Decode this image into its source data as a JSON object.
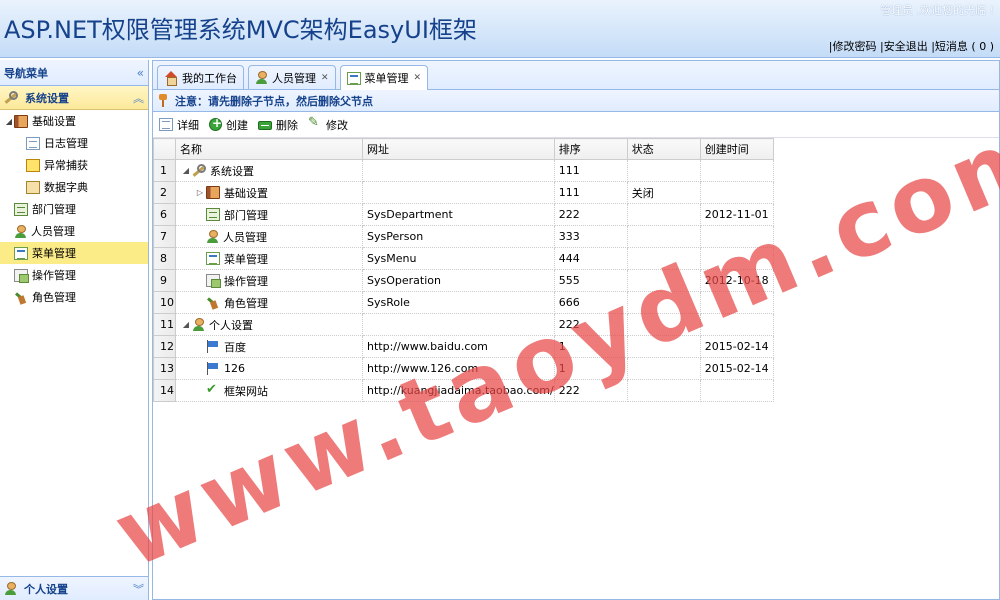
{
  "header": {
    "title": "ASP.NET权限管理系统MVC架构EasyUI框架",
    "welcome": "管理员 ,欢迎您的光临 !",
    "links": [
      "|修改密码",
      "|安全退出",
      "|短消息 ( 0 )"
    ]
  },
  "nav": {
    "title": "导航菜单",
    "collapse_icon": "double-chevron-left-icon",
    "group_top": "系统设置",
    "group_bottom": "个人设置",
    "tree": [
      {
        "label": "基础设置",
        "icon": "book-icon",
        "level": 0,
        "expanded": true
      },
      {
        "label": "日志管理",
        "icon": "log-icon",
        "level": 1
      },
      {
        "label": "异常捕获",
        "icon": "warning-icon",
        "level": 1
      },
      {
        "label": "数据字典",
        "icon": "dictionary-icon",
        "level": 1
      },
      {
        "label": "部门管理",
        "icon": "department-icon",
        "level": 0
      },
      {
        "label": "人员管理",
        "icon": "user-icon",
        "level": 0
      },
      {
        "label": "菜单管理",
        "icon": "menu-icon",
        "level": 0,
        "selected": true
      },
      {
        "label": "操作管理",
        "icon": "operation-icon",
        "level": 0
      },
      {
        "label": "角色管理",
        "icon": "role-icon",
        "level": 0
      }
    ]
  },
  "tabs": [
    {
      "label": "我的工作台",
      "icon": "home-icon",
      "closable": false
    },
    {
      "label": "人员管理",
      "icon": "user-icon",
      "closable": true
    },
    {
      "label": "菜单管理",
      "icon": "menu-icon",
      "closable": true,
      "active": true
    }
  ],
  "notice": "注意：请先删除子节点，然后删除父节点",
  "toolbar": {
    "detail": "详细",
    "create": "创建",
    "delete": "删除",
    "edit": "修改"
  },
  "grid": {
    "columns": [
      "名称",
      "网址",
      "排序",
      "状态",
      "创建时间"
    ],
    "rows": [
      {
        "rn": "1",
        "name": "系统设置",
        "icon": "wrench-icon",
        "indent": 0,
        "toggle": "expanded",
        "url": "",
        "sort": "111",
        "status": "",
        "date": ""
      },
      {
        "rn": "2",
        "name": "基础设置",
        "icon": "book-icon",
        "indent": 1,
        "toggle": "collapsed",
        "url": "",
        "sort": "111",
        "status": "关闭",
        "date": ""
      },
      {
        "rn": "6",
        "name": "部门管理",
        "icon": "department-icon",
        "indent": 1,
        "toggle": "none",
        "url": "SysDepartment",
        "sort": "222",
        "status": "",
        "date": "2012-11-01"
      },
      {
        "rn": "7",
        "name": "人员管理",
        "icon": "user-icon",
        "indent": 1,
        "toggle": "none",
        "url": "SysPerson",
        "sort": "333",
        "status": "",
        "date": ""
      },
      {
        "rn": "8",
        "name": "菜单管理",
        "icon": "menu-icon",
        "indent": 1,
        "toggle": "none",
        "url": "SysMenu",
        "sort": "444",
        "status": "",
        "date": ""
      },
      {
        "rn": "9",
        "name": "操作管理",
        "icon": "operation-icon",
        "indent": 1,
        "toggle": "none",
        "url": "SysOperation",
        "sort": "555",
        "status": "",
        "date": "2012-10-18"
      },
      {
        "rn": "10",
        "name": "角色管理",
        "icon": "role-icon",
        "indent": 1,
        "toggle": "none",
        "url": "SysRole",
        "sort": "666",
        "status": "",
        "date": ""
      },
      {
        "rn": "11",
        "name": "个人设置",
        "icon": "user-icon",
        "indent": 0,
        "toggle": "expanded",
        "url": "",
        "sort": "222",
        "status": "",
        "date": ""
      },
      {
        "rn": "12",
        "name": "百度",
        "icon": "flag-icon",
        "indent": 1,
        "toggle": "none",
        "url": "http://www.baidu.com",
        "sort": "1",
        "status": "",
        "date": "2015-02-14"
      },
      {
        "rn": "13",
        "name": "126",
        "icon": "flag-icon",
        "indent": 1,
        "toggle": "none",
        "url": "http://www.126.com",
        "sort": "1",
        "status": "",
        "date": "2015-02-14"
      },
      {
        "rn": "14",
        "name": "框架网站",
        "icon": "check-icon",
        "indent": 1,
        "toggle": "none",
        "url": "http://kuangjiadaima.taobao.com/",
        "sort": "222",
        "status": "",
        "date": ""
      }
    ]
  },
  "watermark": "www.taoydm.com",
  "colors": {
    "brand": "#15428b",
    "border": "#95b8e7",
    "selected": "#fbec88",
    "watermark": "#e84646"
  }
}
